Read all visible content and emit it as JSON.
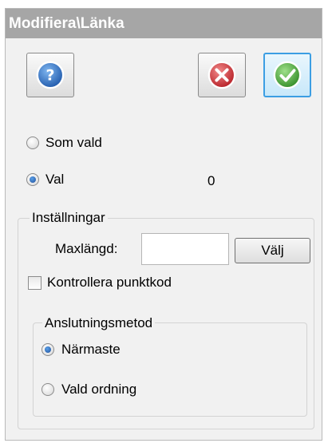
{
  "window": {
    "title": "Modifiera\\Länka"
  },
  "toolbar": {
    "help_icon": "help-icon",
    "cancel_icon": "cancel-icon",
    "ok_icon": "ok-icon",
    "colors": {
      "help": "#1f63b6",
      "cancel": "#c8262d",
      "ok": "#3f9d2f",
      "active_border": "#3c9ee3"
    }
  },
  "selection": {
    "option_som_vald": "Som vald",
    "option_val": "Val",
    "selected": "Val",
    "val_count": "0"
  },
  "settings": {
    "group_label": "Inställningar",
    "maxlength_label": "Maxlängd:",
    "maxlength_value": "",
    "choose_button": "Välj",
    "check_point_code_label": "Kontrollera punktkod",
    "check_point_code_checked": false,
    "connection": {
      "group_label": "Anslutningsmetod",
      "option_nearest": "Närmaste",
      "option_selected_order": "Vald ordning",
      "selected": "Närmaste"
    }
  }
}
